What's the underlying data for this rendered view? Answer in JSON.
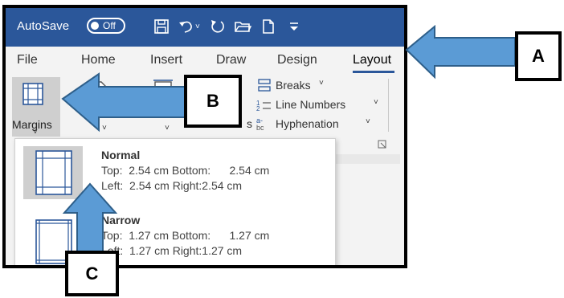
{
  "qat": {
    "autosave_label": "AutoSave",
    "autosave_state": "Off",
    "icons": [
      "save-icon",
      "undo-icon",
      "redo-icon",
      "open-folder-icon",
      "new-document-icon",
      "customize-icon"
    ]
  },
  "tabs": [
    {
      "label": "File"
    },
    {
      "label": "Home"
    },
    {
      "label": "Insert"
    },
    {
      "label": "Draw"
    },
    {
      "label": "Design"
    },
    {
      "label": "Layout"
    }
  ],
  "ribbon": {
    "margins_label": "Margins",
    "breaks_label": "Breaks",
    "line_numbers_label": "Line Numbers",
    "hyphenation_label": "Hyphenation"
  },
  "margins_menu": {
    "presets": [
      {
        "name": "Normal",
        "line1": "Top:  2.54 cm Bottom:      2.54 cm",
        "line2": "Left:  2.54 cm Right:2.54 cm"
      },
      {
        "name": "Narrow",
        "line1": "Top:  1.27 cm Bottom:      1.27 cm",
        "line2": "Left:  1.27 cm Right:1.27 cm"
      }
    ]
  },
  "callouts": {
    "a": "A",
    "b": "B",
    "c": "C"
  },
  "colors": {
    "title_bar": "#2b579a",
    "arrow_fill": "#5b9bd5",
    "arrow_stroke": "#2e5f8a"
  }
}
